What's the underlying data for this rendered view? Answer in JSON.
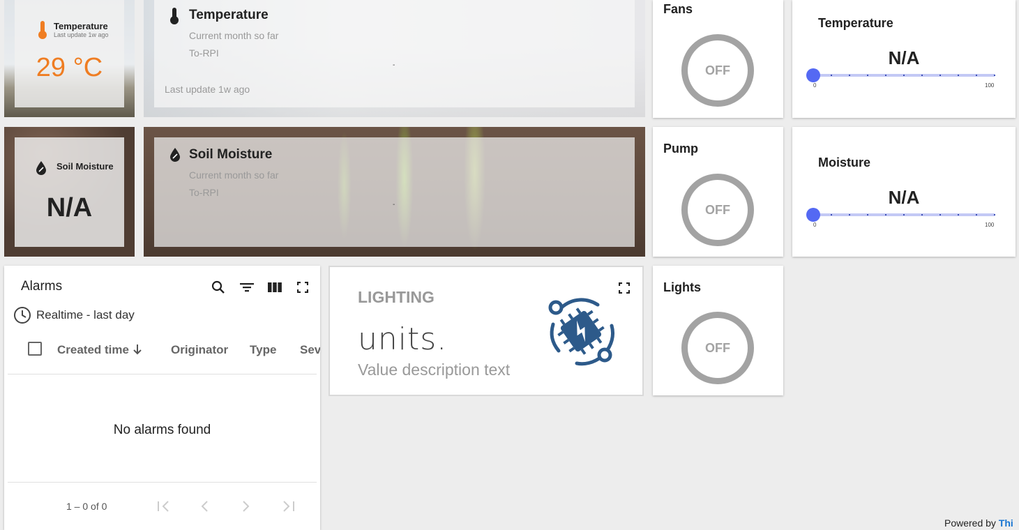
{
  "temperature_small": {
    "title": "Temperature",
    "sub": "Last update 1w ago",
    "value": "29 °C",
    "value_color": "#ef7d22"
  },
  "temperature_chart": {
    "title": "Temperature",
    "period": "Current month so far",
    "device": "To-RPI",
    "dash": "-",
    "footer": "Last update 1w ago"
  },
  "soil_small": {
    "title": "Soil Moisture",
    "value": "N/A"
  },
  "soil_chart": {
    "title": "Soil Moisture",
    "period": "Current month so far",
    "device": "To-RPI",
    "dash": "-"
  },
  "switches": {
    "fans": {
      "label": "Fans",
      "state": "OFF"
    },
    "pump": {
      "label": "Pump",
      "state": "OFF"
    },
    "lights": {
      "label": "Lights",
      "state": "OFF"
    }
  },
  "sliders": {
    "temperature": {
      "label": "Temperature",
      "value": "N/A",
      "min": "0",
      "max": "100",
      "level": 0
    },
    "moisture": {
      "label": "Moisture",
      "value": "N/A",
      "min": "0",
      "max": "100",
      "level": 0
    }
  },
  "alarms": {
    "title": "Alarms",
    "timewindow": "Realtime - last day",
    "columns": {
      "created": "Created time",
      "originator": "Originator",
      "type": "Type",
      "severity": "Sev"
    },
    "empty": "No alarms found",
    "range": "1 – 0 of 0"
  },
  "lighting": {
    "title": "LIGHTING",
    "units": "units.",
    "description": "Value description text"
  },
  "footer": {
    "powered": "Powered by",
    "brand": "Thi",
    "brand_color": "#1976d2"
  },
  "icons": [
    "thermometer-icon",
    "water-drop-icon",
    "search-icon",
    "filter-icon",
    "columns-icon",
    "fullscreen-icon",
    "clock-icon",
    "arrow-down-icon",
    "first-page-icon",
    "prev-page-icon",
    "next-page-icon",
    "last-page-icon",
    "chip-icon"
  ]
}
